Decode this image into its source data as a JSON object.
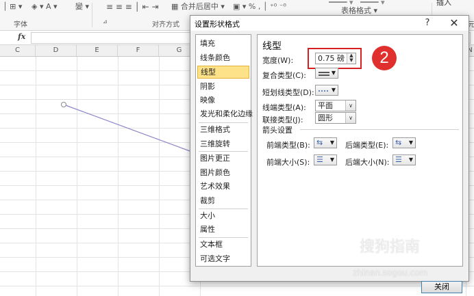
{
  "ribbon": {
    "font_group": "字体",
    "align_group": "对齐方式",
    "merge_center": "合并后居中",
    "number_pct": "%",
    "number_comma": ",",
    "table_format": "表格格式",
    "insert_partial": "插入",
    "other_partial": "元"
  },
  "formula_bar": {
    "fx": "fx"
  },
  "columns": [
    "C",
    "D",
    "E",
    "F",
    "G",
    "N"
  ],
  "dialog": {
    "title": "设置形状格式",
    "help": "?",
    "close_x": "✕",
    "nav": [
      "填充",
      "线条颜色",
      "线型",
      "阴影",
      "映像",
      "发光和柔化边缘",
      "三维格式",
      "三维旋转",
      "图片更正",
      "图片颜色",
      "艺术效果",
      "裁剪",
      "大小",
      "属性",
      "文本框",
      "可选文字"
    ],
    "nav_selected": "线型",
    "panel": {
      "title": "线型",
      "width_label": "宽度(W):",
      "width_value": "0.75 磅",
      "compound_label": "复合类型(C):",
      "dash_label": "短划线类型(D):",
      "cap_label": "线端类型(A):",
      "cap_value": "平面",
      "join_label": "联接类型(J):",
      "join_value": "圆形",
      "arrow_section": "箭头设置",
      "begin_type": "前端类型(B):",
      "end_type": "后端类型(E):",
      "begin_size": "前端大小(S):",
      "end_size": "后端大小(N):"
    },
    "close_button": "关闭"
  },
  "annotation": {
    "step": "2",
    "highlight_color": "#d42020",
    "badge_color": "#e0302e"
  },
  "watermark": {
    "brand": "搜狗指南",
    "url": "zhinan.sogou.com"
  }
}
